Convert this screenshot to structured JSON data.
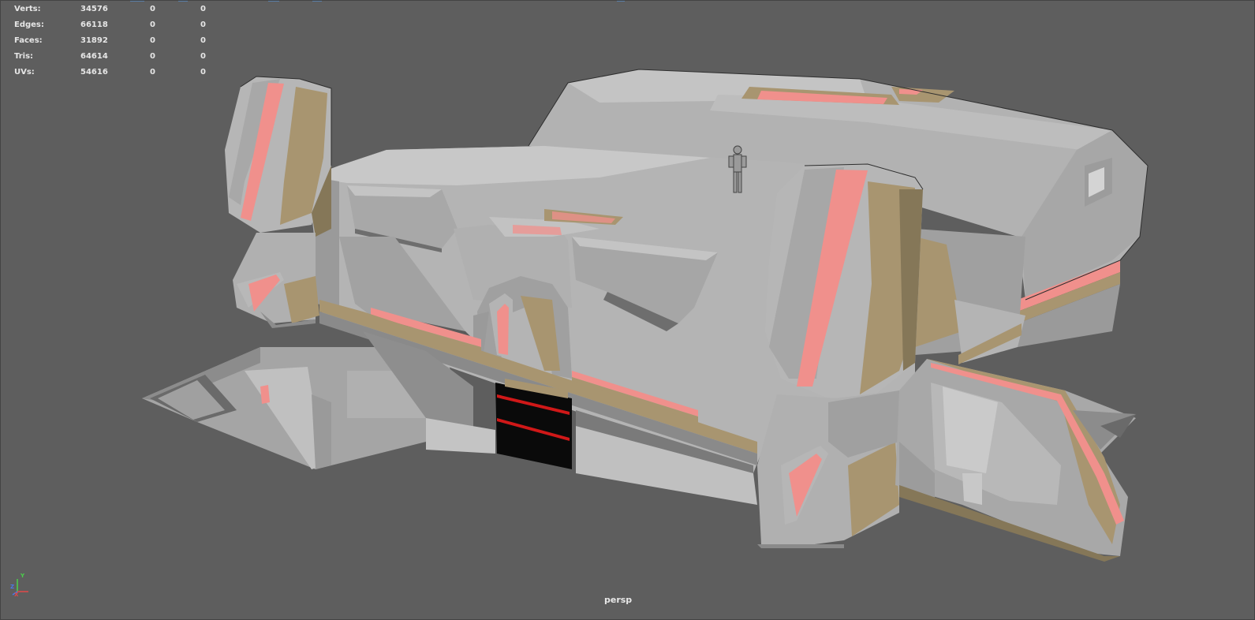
{
  "viewport": {
    "background": "#5e5e5e",
    "camera_name": "persp"
  },
  "hud": {
    "rows": [
      {
        "label": "Verts:",
        "total": "34576",
        "selected": "0",
        "component": "0"
      },
      {
        "label": "Edges:",
        "total": "66118",
        "selected": "0",
        "component": "0"
      },
      {
        "label": "Faces:",
        "total": "31892",
        "selected": "0",
        "component": "0"
      },
      {
        "label": "Tris:",
        "total": "64614",
        "selected": "0",
        "component": "0"
      },
      {
        "label": "UVs:",
        "total": "54616",
        "selected": "0",
        "component": "0"
      }
    ]
  },
  "axis_gizmo": {
    "x_label": "X",
    "y_label": "Y",
    "z_label": "Z",
    "x_color": "#e04848",
    "y_color": "#4ad24a",
    "z_color": "#4a7ae8"
  },
  "model": {
    "name": "sci-fi-building",
    "colors": {
      "gray_light": "#b4b4b4",
      "gray_mid": "#a2a2a2",
      "gray_dark": "#8a8a8a",
      "tan": "#a89570",
      "tan_dark": "#857758",
      "pink": "#f0908c",
      "black": "#0a0a0a",
      "red": "#d01818"
    }
  }
}
